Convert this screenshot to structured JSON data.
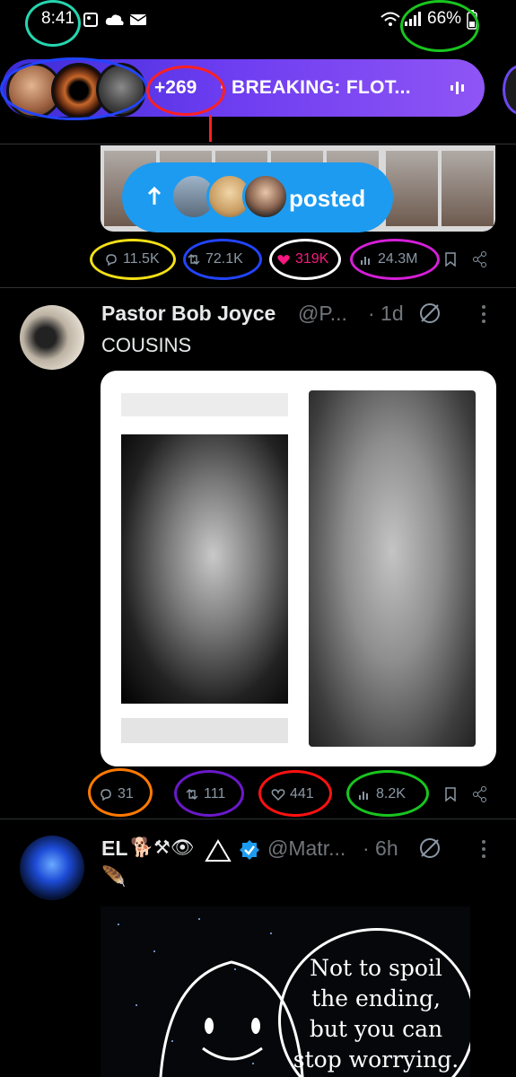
{
  "status_bar": {
    "time": "8:41",
    "battery": "66%"
  },
  "live_bar": {
    "count": "+269",
    "headline": "BREAKING: FLOT...",
    "separator": "·"
  },
  "posted_pill": {
    "label": "posted"
  },
  "tweet1": {
    "actions": {
      "replies": "11.5K",
      "reposts": "72.1K",
      "likes": "319K",
      "views": "24.3M"
    }
  },
  "tweet2": {
    "name": "Pastor Bob Joyce",
    "handle": "@P...",
    "time": "· 1d",
    "text": "COUSINS",
    "actions": {
      "replies": "31",
      "reposts": "111",
      "likes": "441",
      "views": "8.2K"
    }
  },
  "tweet3": {
    "name": "EL",
    "name_emoji": "🐕⚒👁",
    "handle": "@Matr...",
    "time": "· 6h",
    "text": "🪶",
    "meme_text": [
      "Not to spoil",
      "the ending,",
      "but you can",
      "stop worrying."
    ]
  },
  "colors": {
    "accent": "#1d9bf0",
    "like_active": "#f91880",
    "muted": "#71767b"
  }
}
